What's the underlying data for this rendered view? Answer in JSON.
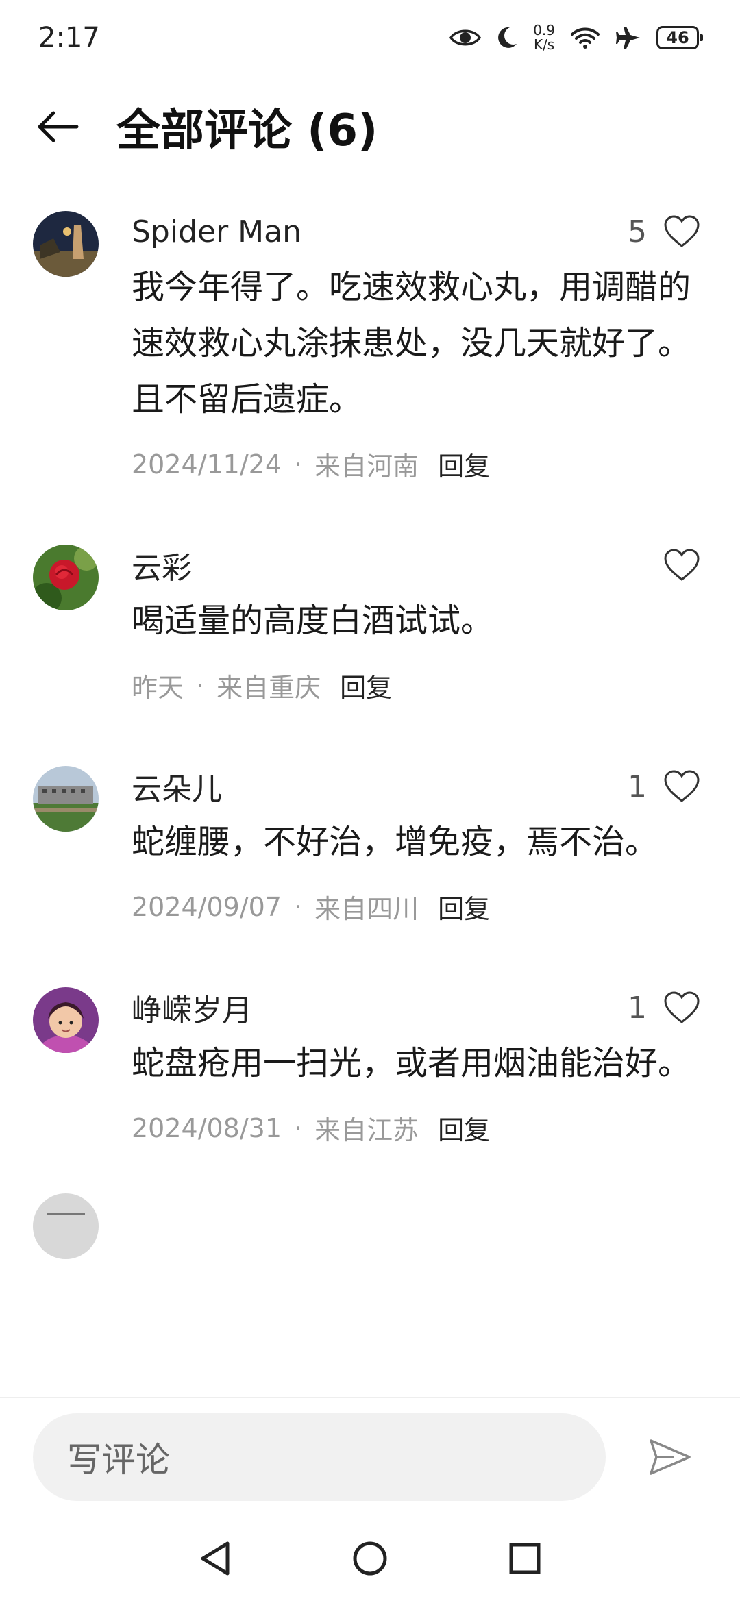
{
  "status_bar": {
    "time": "2:17",
    "net_speed_value": "0.9",
    "net_speed_unit": "K/s",
    "battery": "46"
  },
  "header": {
    "title": "全部评论 (6)"
  },
  "comments": [
    {
      "name": "Spider Man",
      "likes": "5",
      "text": "我今年得了。吃速效救心丸，用调醋的速效救心丸涂抹患处，没几天就好了。且不留后遗症。",
      "date": "2024/11/24",
      "location": "来自河南",
      "reply": "回复"
    },
    {
      "name": "云彩",
      "likes": "",
      "text": "喝适量的高度白酒试试。",
      "date": "昨天",
      "location": "来自重庆",
      "reply": "回复"
    },
    {
      "name": "云朵儿",
      "likes": "1",
      "text": "蛇缠腰，不好治，增免疫，焉不治。",
      "date": "2024/09/07",
      "location": "来自四川",
      "reply": "回复"
    },
    {
      "name": "峥嵘岁月",
      "likes": "1",
      "text": "蛇盘疮用一扫光，或者用烟油能治好。",
      "date": "2024/08/31",
      "location": "来自江苏",
      "reply": "回复"
    }
  ],
  "input": {
    "placeholder": "写评论"
  },
  "icons": {
    "status": [
      "eye-icon",
      "moon-icon",
      "wifi-icon",
      "airplane-icon",
      "battery-icon"
    ],
    "header": "back-arrow-icon",
    "like": "heart-icon",
    "send": "send-icon",
    "nav": [
      "nav-back-icon",
      "nav-home-icon",
      "nav-recents-icon"
    ]
  }
}
